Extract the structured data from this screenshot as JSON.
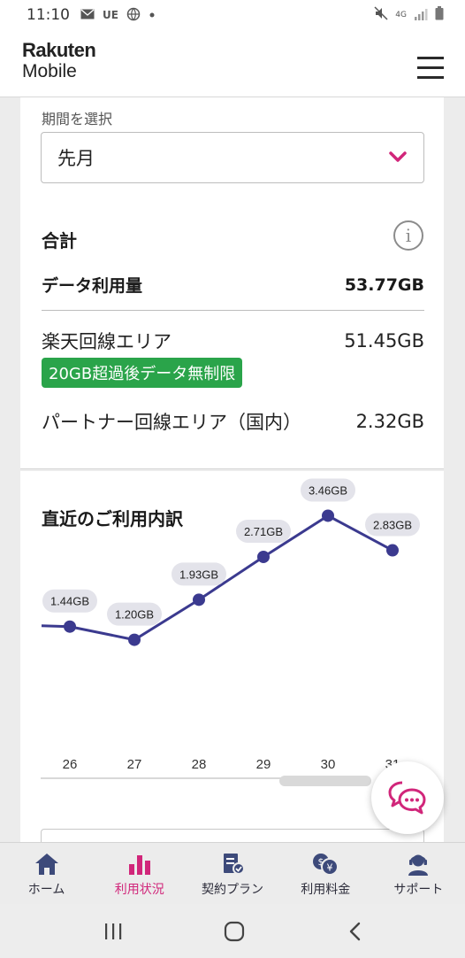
{
  "status_bar": {
    "time": "11:10",
    "carrier": "UE",
    "network": "4G",
    "icons": [
      "mail-icon",
      "globe-icon",
      "dot-icon",
      "mute-icon",
      "signal-icon",
      "battery-icon"
    ]
  },
  "header": {
    "logo_line1": "Rakuten",
    "logo_line2": "Mobile",
    "menu_icon": "hamburger-icon"
  },
  "period": {
    "label": "期間を選択",
    "selected": "先月"
  },
  "totals": {
    "title": "合計",
    "data_usage_label": "データ利用量",
    "data_usage_value": "53.77GB",
    "rakuten_area_label": "楽天回線エリア",
    "rakuten_area_value": "51.45GB",
    "rakuten_badge": "20GB超過後データ無制限",
    "partner_area_label": "パートナー回線エリア（国内）",
    "partner_area_value": "2.32GB"
  },
  "recent": {
    "title": "直近のご利用内訳"
  },
  "chart_data": {
    "type": "line",
    "title": "直近のご利用内訳",
    "categories": [
      "26",
      "27",
      "28",
      "29",
      "30",
      "31"
    ],
    "series": [
      {
        "values": [
          1.44,
          1.2,
          1.93,
          2.71,
          3.46,
          2.83
        ]
      }
    ],
    "data_labels": [
      "1.44GB",
      "1.20GB",
      "1.93GB",
      "2.71GB",
      "3.46GB",
      "2.83GB"
    ],
    "unit": "GB",
    "grid": false,
    "line_color": "#3b3a8f"
  },
  "bottom_nav": {
    "items": [
      {
        "label": "ホーム",
        "icon": "home-icon",
        "active": false
      },
      {
        "label": "利用状況",
        "icon": "bar-chart-icon",
        "active": true
      },
      {
        "label": "契約プラン",
        "icon": "contract-icon",
        "active": false
      },
      {
        "label": "利用料金",
        "icon": "fee-icon",
        "active": false
      },
      {
        "label": "サポート",
        "icon": "support-icon",
        "active": false
      }
    ]
  },
  "colors": {
    "accent": "#d1267a",
    "badge_green": "#2aa44a",
    "chart_line": "#3b3a8f"
  }
}
